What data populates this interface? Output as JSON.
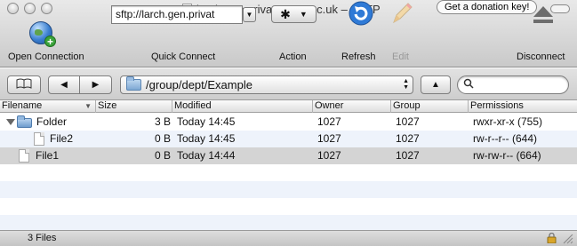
{
  "window": {
    "title": "larch.gen.private.cam.ac.uk – SFTP",
    "donate_button": "Get a donation key!"
  },
  "toolbar": {
    "open_connection": "Open Connection",
    "quick_connect_value": "sftp://larch.gen.privat",
    "quick_connect": "Quick Connect",
    "action": "Action",
    "refresh": "Refresh",
    "edit": "Edit",
    "disconnect": "Disconnect"
  },
  "navbar": {
    "path": "/group/dept/Example",
    "search_placeholder": ""
  },
  "table": {
    "headers": {
      "filename": "Filename",
      "size": "Size",
      "modified": "Modified",
      "owner": "Owner",
      "group": "Group",
      "permissions": "Permissions"
    },
    "rows": [
      {
        "name": "Folder",
        "size": "3 B",
        "modified": "Today 14:45",
        "owner": "1027",
        "group": "1027",
        "permissions": "rwxr-xr-x (755)"
      },
      {
        "name": "File2",
        "size": "0 B",
        "modified": "Today 14:45",
        "owner": "1027",
        "group": "1027",
        "permissions": "rw-r--r-- (644)"
      },
      {
        "name": "File1",
        "size": "0 B",
        "modified": "Today 14:44",
        "owner": "1027",
        "group": "1027",
        "permissions": "rw-rw-r-- (664)"
      }
    ]
  },
  "status": {
    "text": "3 Files"
  }
}
